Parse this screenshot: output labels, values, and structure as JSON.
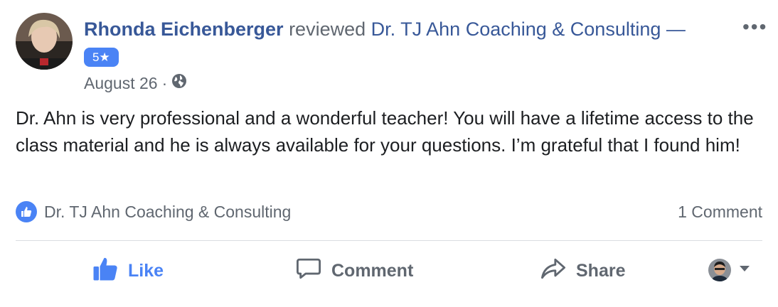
{
  "review": {
    "author": "Rhonda Eichenberger",
    "verb": "reviewed",
    "page": "Dr. TJ Ahn Coaching & Consulting —",
    "rating": "5★",
    "date": "August 26",
    "separator": "·",
    "privacy_icon": "globe-icon",
    "text": "Dr. Ahn is very professional and a wonderful teacher! You will have a lifetime access to the class material and he is always available for your questions. I’m grateful that I found him!"
  },
  "reactions": {
    "liked_by": "Dr. TJ Ahn Coaching & Consulting",
    "comment_count": "1 Comment",
    "icon": "thumbs-up-icon"
  },
  "actions": {
    "like": "Like",
    "comment": "Comment",
    "share": "Share"
  },
  "menu": {
    "more_icon": "more-dots-icon",
    "more_label": "•••"
  },
  "colors": {
    "link": "#385898",
    "accent": "#4a83f5",
    "muted": "#606770",
    "text": "#1c1e21"
  }
}
